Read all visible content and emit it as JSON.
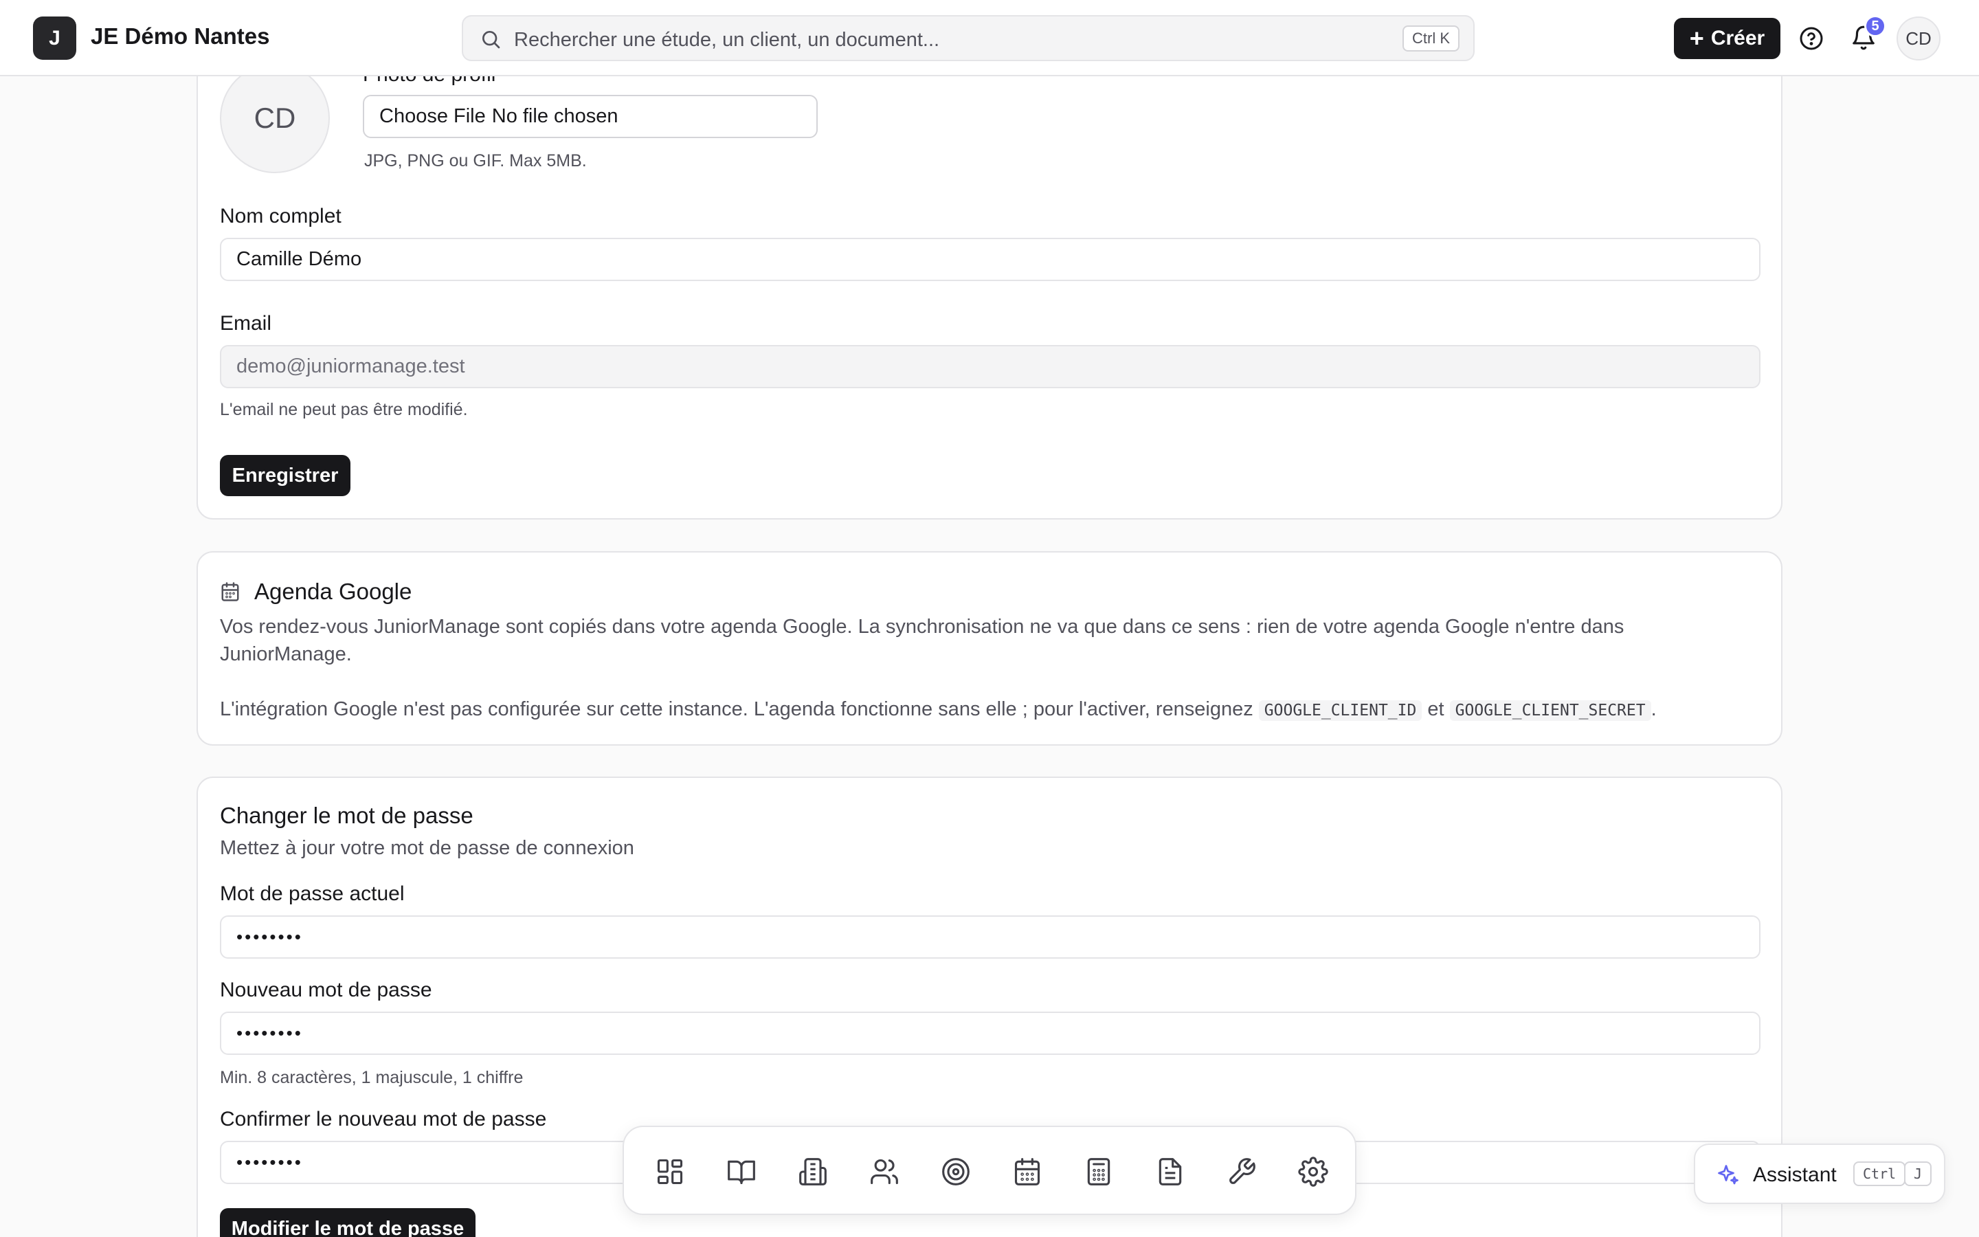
{
  "header": {
    "org_initial": "J",
    "org_name": "JE Démo Nantes",
    "search_placeholder": "Rechercher une étude, un client, un document...",
    "search_shortcut": "Ctrl K",
    "create_label": "Créer",
    "notification_count": "5",
    "user_initials": "CD"
  },
  "profile": {
    "photo_label": "Photo de profil",
    "avatar_initials": "CD",
    "file_choose_label": "Choose File",
    "file_status": "No file chosen",
    "file_hint": "JPG, PNG ou GIF. Max 5MB.",
    "name_label": "Nom complet",
    "name_value": "Camille Démo",
    "email_label": "Email",
    "email_value": "demo@juniormanage.test",
    "email_hint": "L'email ne peut pas être modifié.",
    "save_label": "Enregistrer"
  },
  "agenda": {
    "title": "Agenda Google",
    "description": "Vos rendez-vous JuniorManage sont copiés dans votre agenda Google. La synchronisation ne va que dans ce sens : rien de votre agenda Google n'entre dans JuniorManage.",
    "note_prefix": "L'intégration Google n'est pas configurée sur cette instance. L'agenda fonctionne sans elle ; pour l'activer, renseignez",
    "code_client_id": "GOOGLE_CLIENT_ID",
    "note_and": "et",
    "code_client_secret": "GOOGLE_CLIENT_SECRET",
    "note_suffix": "."
  },
  "password": {
    "title": "Changer le mot de passe",
    "subtitle": "Mettez à jour votre mot de passe de connexion",
    "current_label": "Mot de passe actuel",
    "current_value": "••••••••",
    "new_label": "Nouveau mot de passe",
    "new_value": "••••••••",
    "new_hint": "Min. 8 caractères, 1 majuscule, 1 chiffre",
    "confirm_label": "Confirmer le nouveau mot de passe",
    "confirm_value": "••••••••",
    "submit_label": "Modifier le mot de passe"
  },
  "dock": {
    "items": [
      {
        "icon": "dashboard-icon"
      },
      {
        "icon": "book-open-icon"
      },
      {
        "icon": "building-icon"
      },
      {
        "icon": "users-icon"
      },
      {
        "icon": "target-icon"
      },
      {
        "icon": "calendar-icon"
      },
      {
        "icon": "calculator-icon"
      },
      {
        "icon": "document-icon"
      },
      {
        "icon": "wrench-icon"
      },
      {
        "icon": "gear-icon"
      }
    ]
  },
  "assistant": {
    "label": "Assistant",
    "shortcut_modifier": "Ctrl",
    "shortcut_key": "J"
  },
  "colors": {
    "primary_dark": "#18181b",
    "badge": "#6366f1",
    "border": "#e4e4e7",
    "muted_text": "#52525b"
  }
}
